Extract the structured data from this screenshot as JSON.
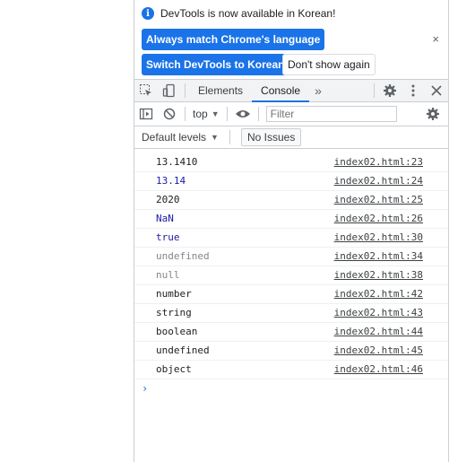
{
  "infobar": {
    "message": "DevTools is now available in Korean!",
    "match_button": "Always match Chrome's language",
    "switch_button": "Switch DevTools to Korean",
    "dismiss_button": "Don't show again",
    "close_symbol": "×"
  },
  "toolbar": {
    "tabs": [
      {
        "label": "Elements",
        "active": false
      },
      {
        "label": "Console",
        "active": true
      }
    ],
    "more_tabs_symbol": "»"
  },
  "console_toolbar": {
    "context": "top",
    "filter_placeholder": "Filter"
  },
  "levels_bar": {
    "levels_label": "Default levels",
    "issues_label": "No Issues"
  },
  "messages": [
    {
      "value": "13.1410",
      "source": "index02.html:23",
      "color": "#202124"
    },
    {
      "value": "13.14",
      "source": "index02.html:24",
      "color": "#1a1aa6"
    },
    {
      "value": "2020",
      "source": "index02.html:25",
      "color": "#202124"
    },
    {
      "value": "NaN",
      "source": "index02.html:26",
      "color": "#1a1aa6"
    },
    {
      "value": "true",
      "source": "index02.html:30",
      "color": "#1a1aa6"
    },
    {
      "value": "undefined",
      "source": "index02.html:34",
      "color": "#80868b"
    },
    {
      "value": "null",
      "source": "index02.html:38",
      "color": "#80868b"
    },
    {
      "value": "number",
      "source": "index02.html:42",
      "color": "#202124"
    },
    {
      "value": "string",
      "source": "index02.html:43",
      "color": "#202124"
    },
    {
      "value": "boolean",
      "source": "index02.html:44",
      "color": "#202124"
    },
    {
      "value": "undefined",
      "source": "index02.html:45",
      "color": "#202124"
    },
    {
      "value": "object",
      "source": "index02.html:46",
      "color": "#202124"
    }
  ],
  "prompt_symbol": "›",
  "colors": {
    "accent": "#1a73e8"
  }
}
